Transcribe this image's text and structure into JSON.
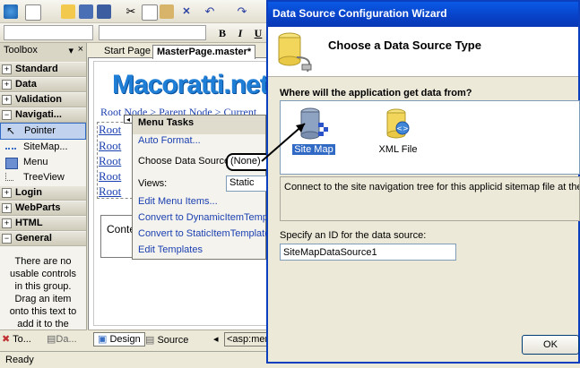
{
  "ide": {
    "format_buttons": [
      "B",
      "I",
      "U"
    ],
    "toolbox": {
      "title": "Toolbox",
      "categories_top": [
        {
          "sign": "+",
          "label": "Standard"
        },
        {
          "sign": "+",
          "label": "Data"
        },
        {
          "sign": "+",
          "label": "Validation"
        },
        {
          "sign": "−",
          "label": "Navigati..."
        }
      ],
      "nav_items": [
        {
          "label": "Pointer",
          "icon": "pointer-icon",
          "selected": true
        },
        {
          "label": "SiteMap...",
          "icon": "sitemappath-icon",
          "selected": false
        },
        {
          "label": "Menu",
          "icon": "menu-icon",
          "selected": false
        },
        {
          "label": "TreeView",
          "icon": "treeview-icon",
          "selected": false
        }
      ],
      "categories_bottom": [
        {
          "sign": "+",
          "label": "Login"
        },
        {
          "sign": "+",
          "label": "WebParts"
        },
        {
          "sign": "+",
          "label": "HTML"
        },
        {
          "sign": "−",
          "label": "General"
        }
      ],
      "empty_message": "There are no usable controls in this group. Drag an item onto this text to add it to the"
    },
    "tabs": {
      "start_page": "Start Page",
      "master": "MasterPage.master*"
    },
    "logo_text": "Macoratti.net",
    "breadcrumb": "Root Node > Parent Node > Current",
    "root_items": [
      "Root",
      "Root",
      "Root",
      "Root",
      "Root"
    ],
    "content_label": "Conte",
    "menu_tasks": {
      "title": "Menu Tasks",
      "auto_format": "Auto Format...",
      "choose_ds_label": "Choose Data Source:",
      "choose_ds_value": "(None)",
      "views_label": "Views:",
      "views_value": "Static",
      "edit_menu_items": "Edit Menu Items...",
      "convert_dynamic": "Convert to DynamicItemTemplate",
      "convert_static": "Convert to StaticItemTemplate",
      "edit_templates": "Edit Templates"
    },
    "bottom_tabs": {
      "design": "Design",
      "source": "Source",
      "tag": "<asp:men"
    },
    "toolbox_bottom_tabs": [
      "To...",
      "Da..."
    ],
    "status": "Ready"
  },
  "wizard": {
    "title": "Data Source Configuration Wizard",
    "heading": "Choose a Data Source Type",
    "question": "Where will the application get data from?",
    "types": [
      {
        "label": "Site Map",
        "icon": "sitemap-database-icon",
        "selected": true
      },
      {
        "label": "XML File",
        "icon": "xml-file-icon",
        "selected": false
      }
    ],
    "description": "Connect to the site navigation tree for this applicid sitemap file at the applica",
    "id_label": "Specify an ID for the data source:",
    "id_value": "SiteMapDataSource1",
    "ok_label": "OK"
  },
  "colors": {
    "title_blue": "#0a5ae6",
    "selection": "#316ac5",
    "link": "#1a3fb0",
    "logo": "#1f7fd6"
  }
}
